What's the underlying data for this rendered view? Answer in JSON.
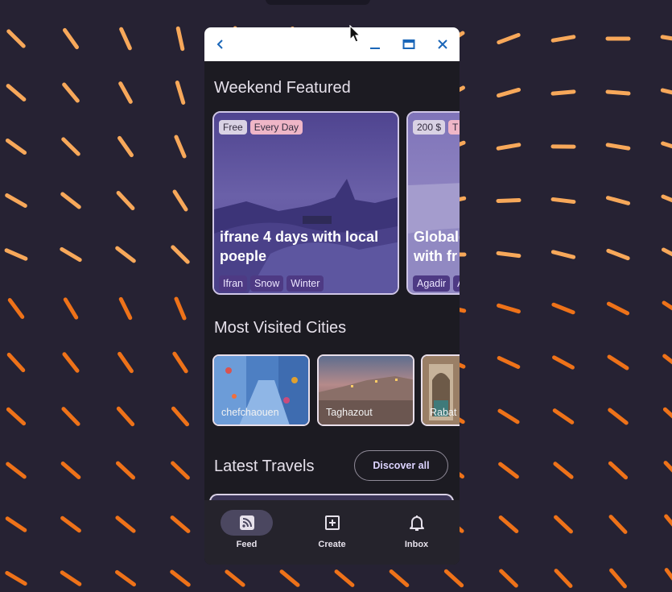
{
  "wallpaper": {
    "colors": {
      "background": "#262233",
      "dash_light": "#f7a85a",
      "dash_dark": "#ee7219"
    }
  },
  "window": {
    "titlebar": {
      "back_icon": "chevron-left-icon",
      "minimize_icon": "minimize-icon",
      "maximize_icon": "maximize-icon",
      "close_icon": "close-icon",
      "accent": "#1a66b8"
    }
  },
  "featured": {
    "title": "Weekend Featured",
    "cards": [
      {
        "price": "Free",
        "when": "Every Day",
        "title": "ifrane 4 days with local poeple",
        "tags": [
          "Ifran",
          "Snow",
          "Winter"
        ]
      },
      {
        "price": "200 $",
        "when": "T",
        "title": "Globale with fr",
        "tags": [
          "Agadir",
          "A"
        ]
      }
    ]
  },
  "cities": {
    "title": "Most Visited Cities",
    "items": [
      {
        "name": "chefchaouen"
      },
      {
        "name": "Taghazout"
      },
      {
        "name": "Rabat"
      }
    ]
  },
  "latest": {
    "title": "Latest Travels",
    "discover_label": "Discover all"
  },
  "nav": {
    "items": [
      {
        "label": "Feed",
        "icon": "rss-feed-icon",
        "active": true
      },
      {
        "label": "Create",
        "icon": "add-box-icon",
        "active": false
      },
      {
        "label": "Inbox",
        "icon": "bell-icon",
        "active": false
      }
    ]
  }
}
